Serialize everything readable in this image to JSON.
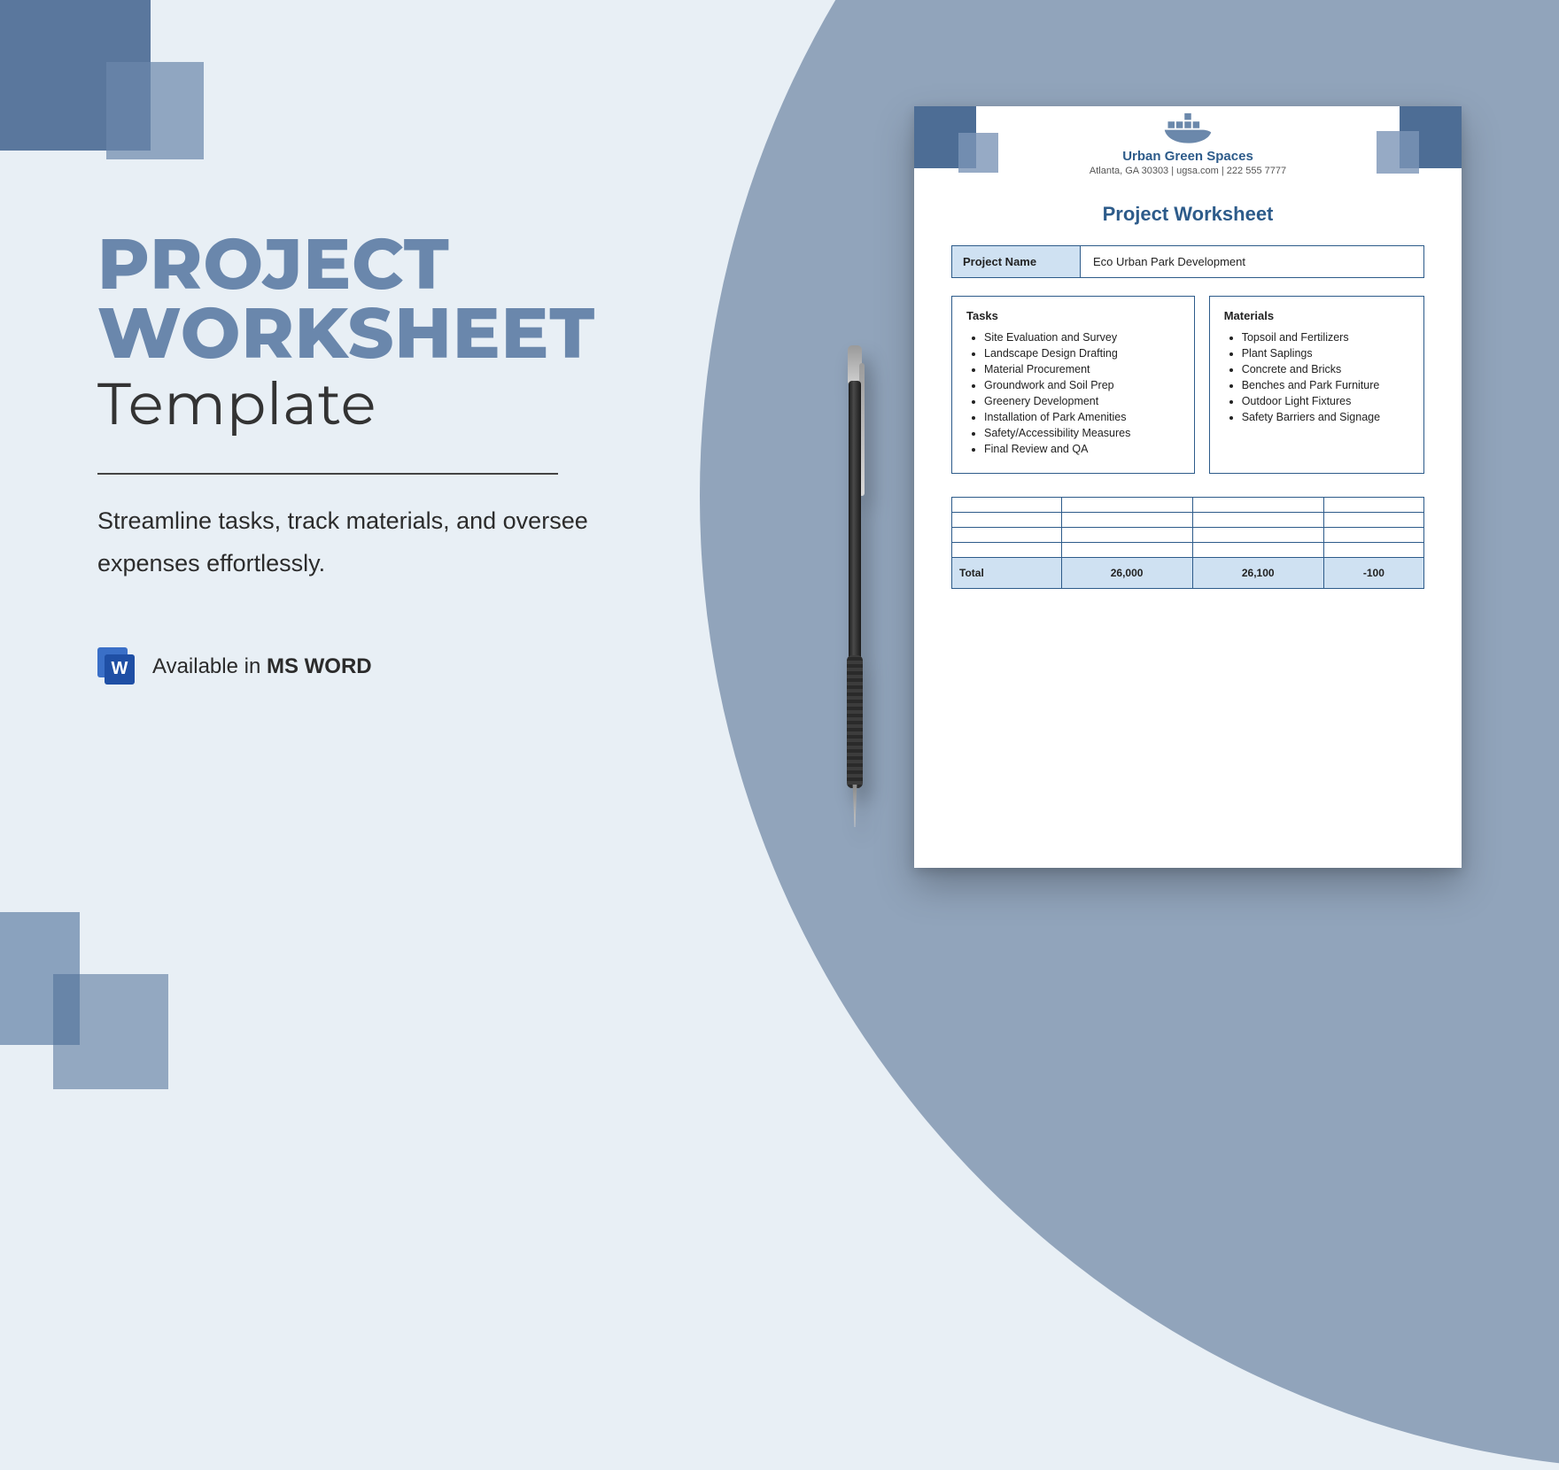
{
  "hero": {
    "title_line1": "PROJECT",
    "title_line2": "WORKSHEET",
    "subtitle": "Template",
    "blurb": "Streamline tasks, track materials, and oversee expenses effortlessly.",
    "available_prefix": "Available in ",
    "available_app": "MS WORD",
    "word_glyph": "W"
  },
  "doc": {
    "org_name": "Urban Green Spaces",
    "org_meta": "Atlanta, GA 30303 | ugsa.com | 222 555 7777",
    "heading": "Project Worksheet",
    "project_name_label": "Project Name",
    "project_name_value": "Eco Urban Park Development",
    "tasks_heading": "Tasks",
    "tasks": [
      "Site Evaluation and Survey",
      "Landscape Design Drafting",
      "Material Procurement",
      "Groundwork and Soil Prep",
      "Greenery Development",
      "Installation of Park Amenities",
      "Safety/Accessibility Measures",
      "Final Review and QA"
    ],
    "materials_heading": "Materials",
    "materials": [
      "Topsoil and Fertilizers",
      "Plant Saplings",
      "Concrete and Bricks",
      "Benches and Park Furniture",
      "Outdoor Light Fixtures",
      "Safety Barriers and Signage"
    ],
    "totals": {
      "label": "Total",
      "col1": "26,000",
      "col2": "26,100",
      "col3": "-100"
    }
  }
}
